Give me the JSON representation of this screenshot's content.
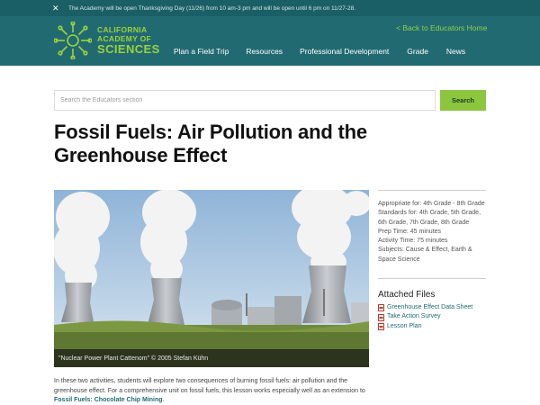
{
  "alert": {
    "close_glyph": "✕",
    "text": "The Academy will be open Thanksgiving Day (11/26) from 10 am-3 pm and will be open until 6 pm on 11/27-28."
  },
  "header": {
    "logo": {
      "line1": "CALIFORNIA",
      "line2": "ACADEMY OF",
      "line3": "SCIENCES",
      "icon": "sunburst-logo-icon",
      "color": "#9ad23b"
    },
    "back_link": "< Back to Educators Home",
    "nav": [
      "Plan a Field Trip",
      "Resources",
      "Professional Development",
      "Grade",
      "News"
    ],
    "background": "#226a72"
  },
  "search": {
    "placeholder": "Search the Educators section",
    "button_label": "Search",
    "button_color": "#8cc63f"
  },
  "page": {
    "title": "Fossil Fuels: Air Pollution and the Greenhouse Effect",
    "hero_caption": "\"Nuclear Power Plant Cattenom\" © 2005 Stefan Kühn",
    "intro_text": "In these two activities, students will explore two consequences of burning fossil fuels: air pollution and the greenhouse effect. For a comprehensive unit on fossil fuels, this lesson works especially well as an extension to ",
    "intro_link": "Fossil Fuels: Chocolate Chip Mining",
    "intro_end": "."
  },
  "sidebar": {
    "meta": [
      "Appropriate for: 4th Grade - 8th Grade",
      "Standards for: 4th Grade, 5th Grade, 6th Grade, 7th Grade, 8th Grade",
      "Prep Time: 45 minutes",
      "Activity Time: 75 minutes",
      "Subjects: Cause & Effect, Earth & Space Science"
    ],
    "files_title": "Attached Files",
    "files": [
      "Greenhouse Effect Data Sheet",
      "Take Action Survey",
      "Lesson Plan"
    ],
    "file_icon": "pdf-icon"
  }
}
